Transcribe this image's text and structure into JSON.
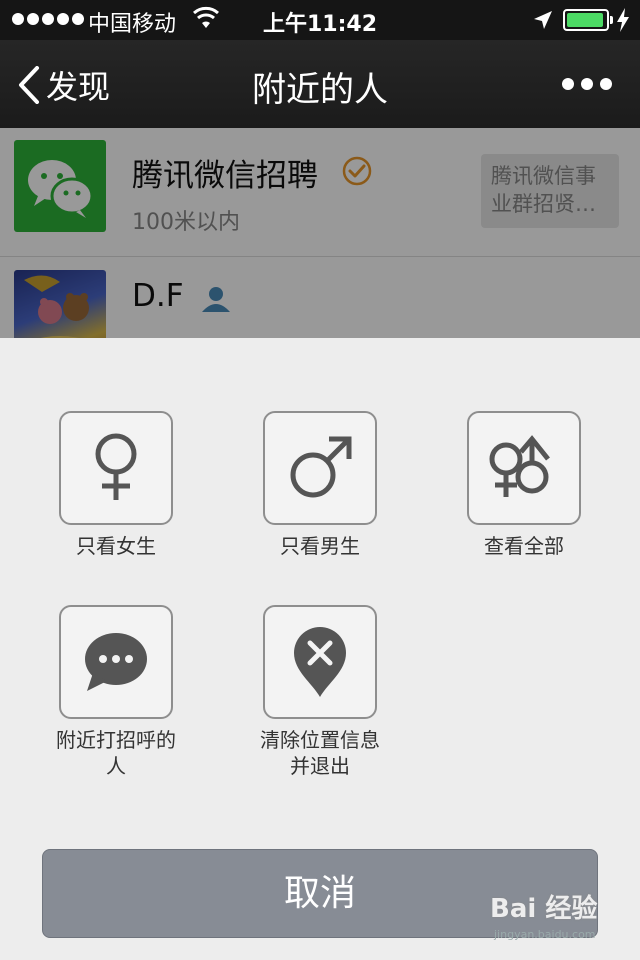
{
  "status_bar": {
    "carrier": "中国移动",
    "time": "上午11:42"
  },
  "nav": {
    "back_label": "发现",
    "title": "附近的人"
  },
  "people": [
    {
      "name": "腾讯微信招聘",
      "distance": "100米以内",
      "tag": "腾讯微信事业群招贤…",
      "avatar": "wechat-logo"
    },
    {
      "name": "D.F",
      "avatar": "cartoon-bears"
    }
  ],
  "actions": [
    {
      "label": "只看女生",
      "icon": "female-symbol-icon"
    },
    {
      "label": "只看男生",
      "icon": "male-symbol-icon"
    },
    {
      "label": "查看全部",
      "icon": "all-genders-icon"
    },
    {
      "label": "附近打招呼的人",
      "icon": "chat-bubble-icon"
    },
    {
      "label": "清除位置信息并退出",
      "icon": "clear-location-icon"
    }
  ],
  "cancel_label": "取消",
  "watermark": {
    "main": "Bai 经验",
    "sub": "jingyan.baidu.com"
  },
  "colors": {
    "status_bar": "#151515",
    "nav_bar": "#222222",
    "wechat_green": "#2db23a",
    "battery_green": "#4cd964",
    "sheet_bg": "#ededed",
    "cancel_button": "#878c95",
    "verified_orange": "#e8962a"
  }
}
